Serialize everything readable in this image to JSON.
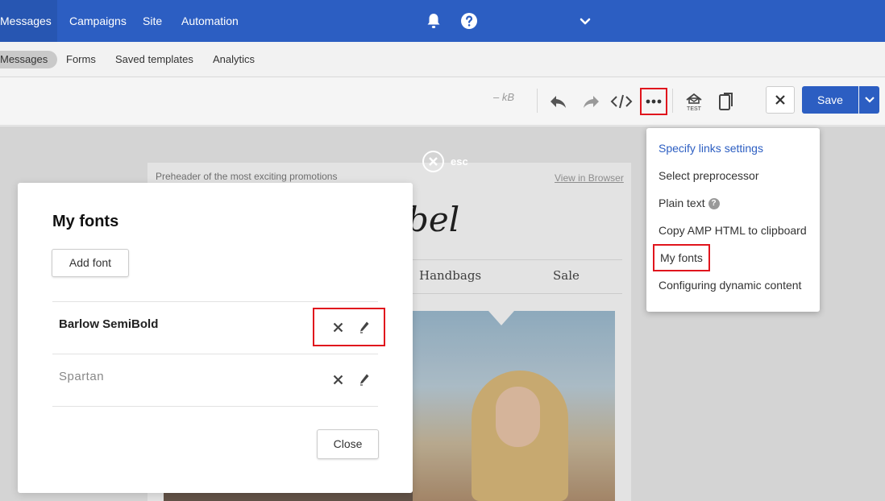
{
  "topnav": {
    "items": [
      "Messages",
      "Campaigns",
      "Site",
      "Automation"
    ],
    "icons": [
      "bell-icon",
      "help-icon",
      "chevron-down-icon"
    ],
    "color": "#2c5ec2"
  },
  "subnav": {
    "items": [
      "Messages",
      "Forms",
      "Saved templates",
      "Analytics"
    ]
  },
  "toolbar": {
    "size": "– kB",
    "save_label": "Save",
    "icons": [
      "undo-icon",
      "redo-icon",
      "code-icon",
      "more-icon",
      "test-icon",
      "mobile-preview-icon",
      "close-icon",
      "chevron-down-icon"
    ]
  },
  "esc_label": "esc",
  "email": {
    "preheader": "Preheader of the most exciting promotions",
    "view_in_browser": "View in Browser",
    "logo_partial": "bel",
    "menu": [
      "Handbags",
      "Sale"
    ]
  },
  "dropdown": {
    "items": [
      "Specify links settings",
      "Select preprocessor",
      "Plain text",
      "Copy AMP HTML to clipboard",
      "My fonts",
      "Configuring dynamic content"
    ],
    "help_glyph": "?"
  },
  "modal": {
    "title": "My fonts",
    "add_font_label": "Add font",
    "fonts": [
      "Barlow SemiBold",
      "Spartan"
    ],
    "close_label": "Close"
  },
  "colors": {
    "accent": "#2c5ec2",
    "highlight": "#e0151d"
  }
}
